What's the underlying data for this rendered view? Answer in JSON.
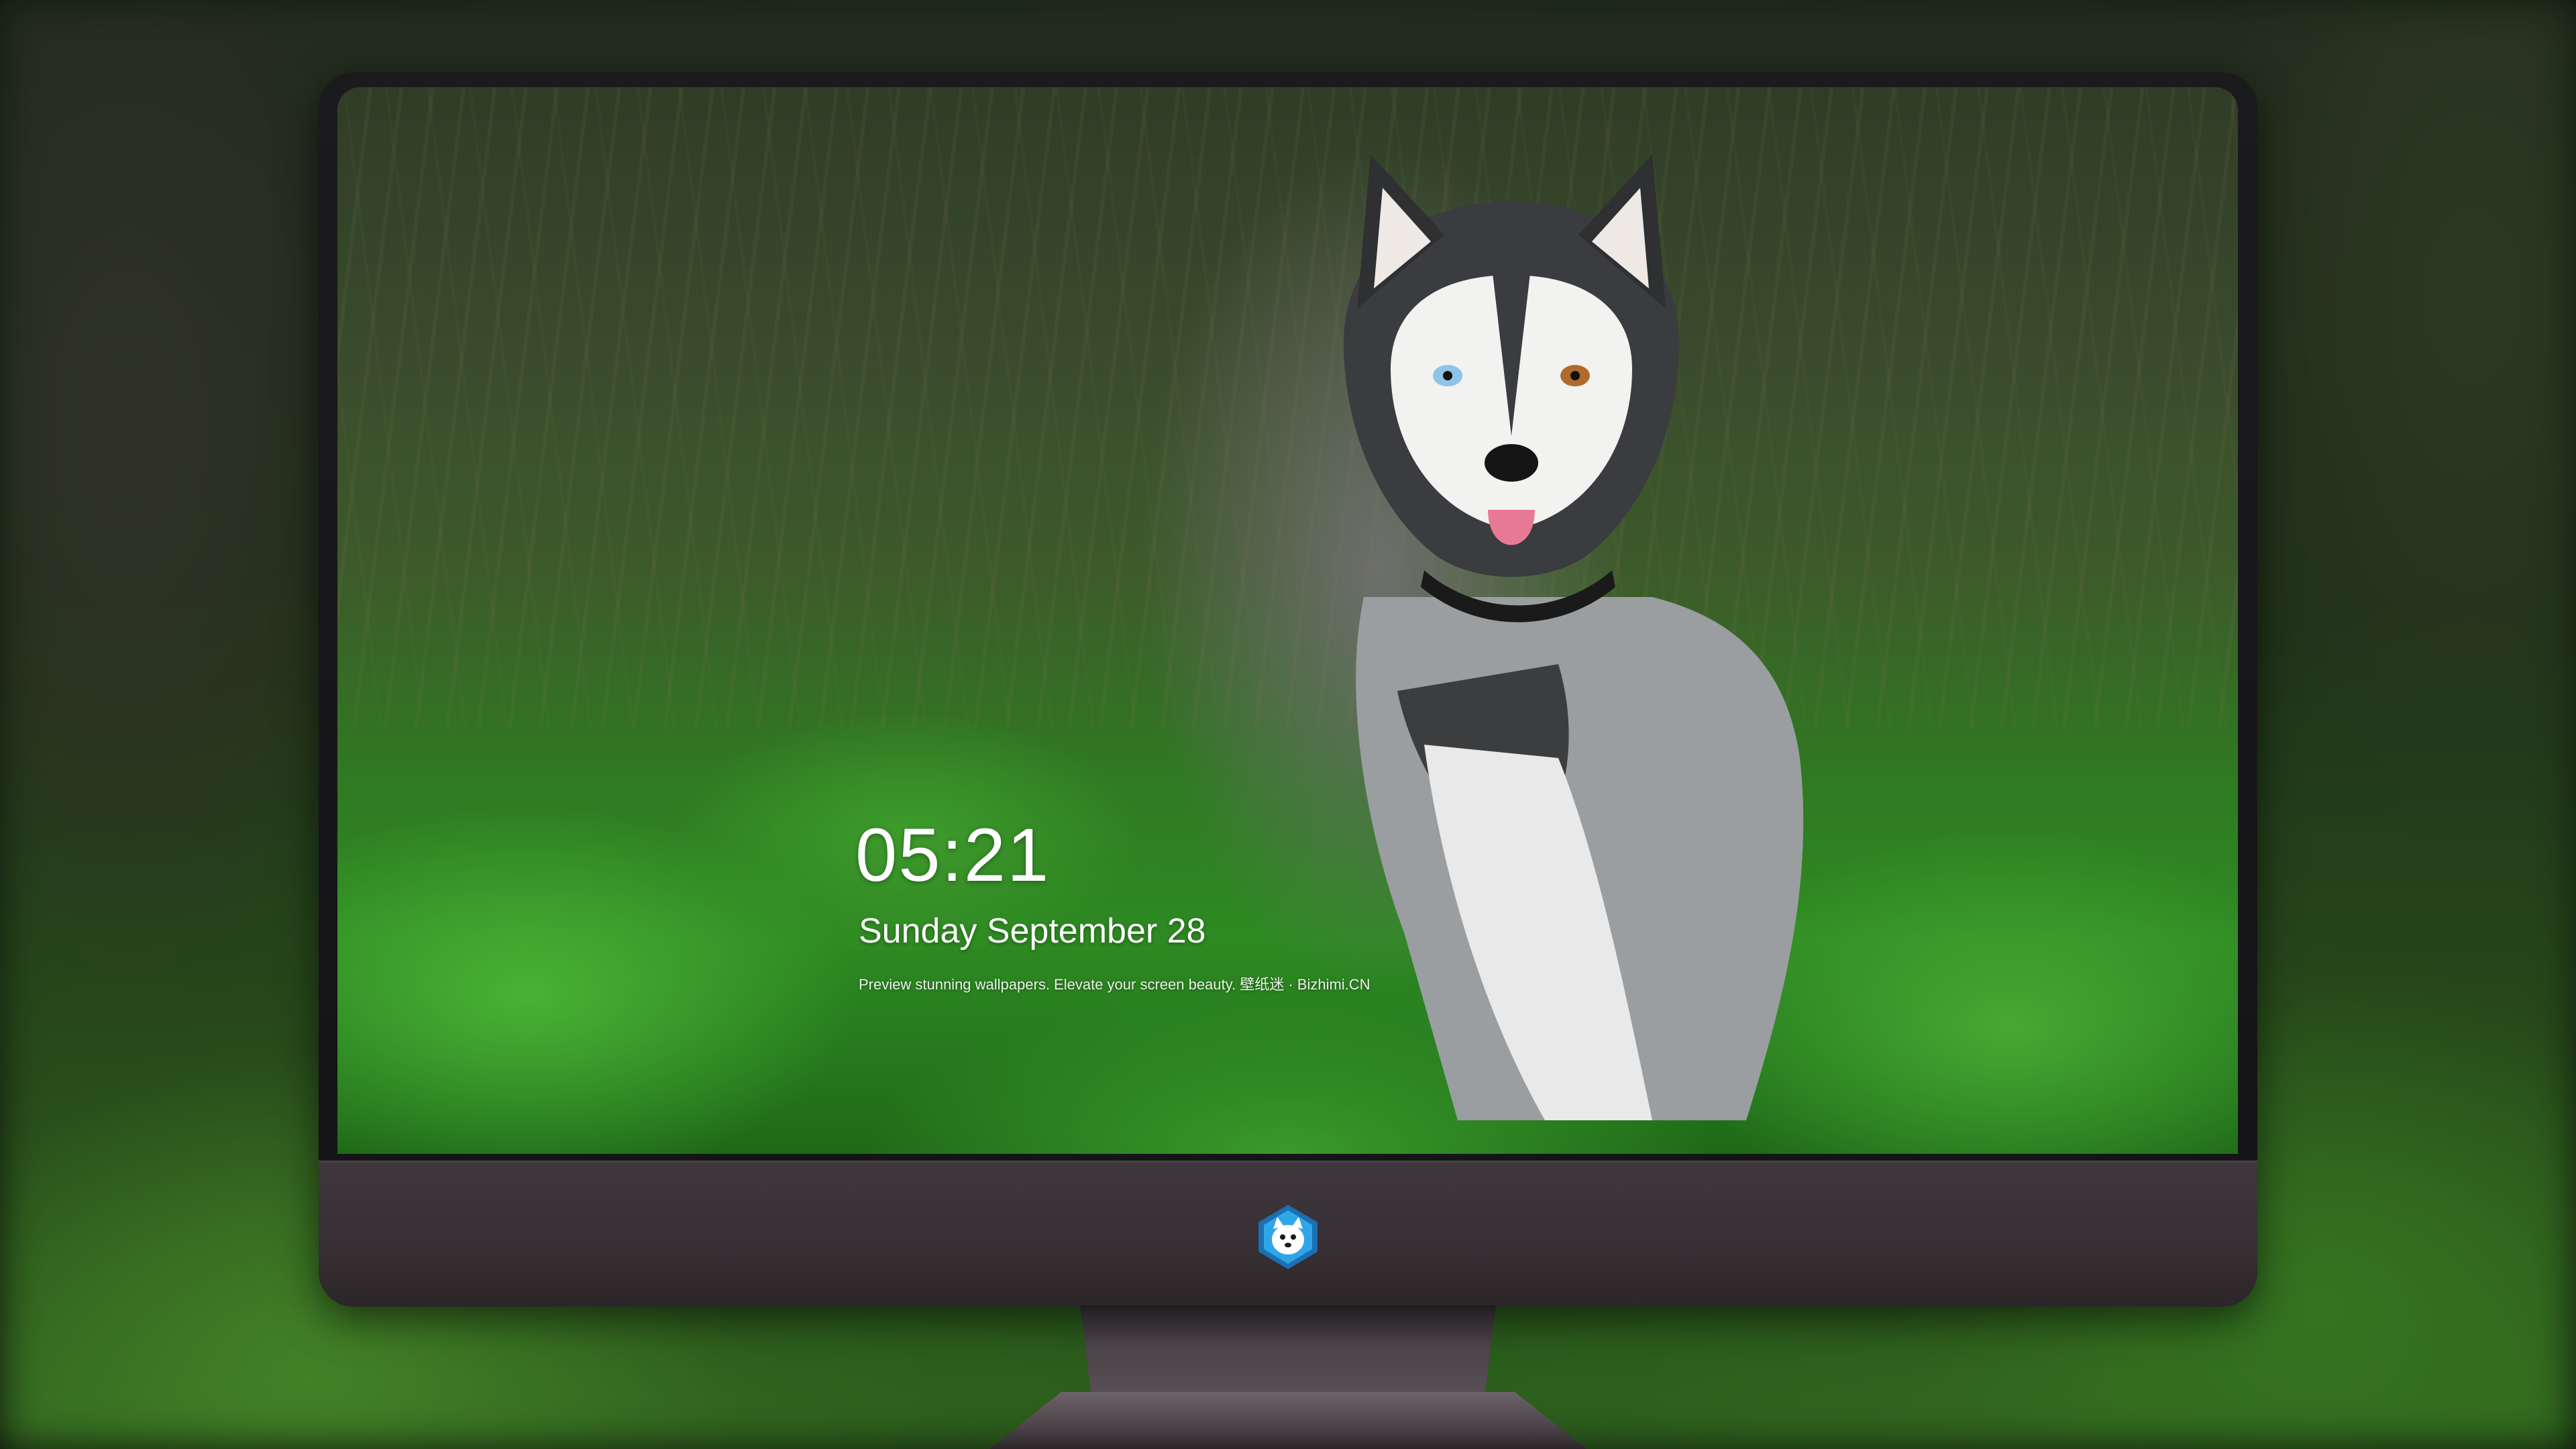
{
  "lockscreen": {
    "time": "05:21",
    "date": "Sunday September  28",
    "tagline": "Preview stunning wallpapers. Elevate your screen beauty. 壁纸迷 · Bizhimi.CN"
  },
  "dock": {
    "apps": [
      {
        "icon": "messages-icon",
        "color": "#34c759"
      },
      {
        "icon": "weather-icon",
        "color": "#2f8ff0"
      },
      {
        "icon": "clock-icon",
        "color": "#ffffff"
      },
      {
        "icon": "preview-icon",
        "color": "#f5c542"
      },
      {
        "icon": "claquette-icon",
        "color": "#2bb3c8"
      },
      {
        "icon": "notes-icon",
        "color": "#ffd60a"
      },
      {
        "icon": "photo-collage-icon",
        "color": "#e9e9e9"
      },
      {
        "icon": "music-icon",
        "color": "#e84bd8"
      },
      {
        "icon": "app-store-icon",
        "color": "#1e7bf5"
      },
      {
        "icon": "camera-icon",
        "color": "#8e8e93"
      }
    ]
  },
  "brand": {
    "icon": "bizhimi-husky-logo-icon"
  }
}
